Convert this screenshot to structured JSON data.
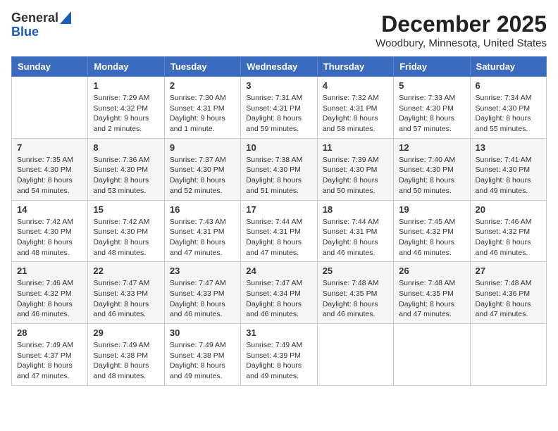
{
  "header": {
    "logo_general": "General",
    "logo_blue": "Blue",
    "month_title": "December 2025",
    "location": "Woodbury, Minnesota, United States"
  },
  "weekdays": [
    "Sunday",
    "Monday",
    "Tuesday",
    "Wednesday",
    "Thursday",
    "Friday",
    "Saturday"
  ],
  "weeks": [
    [
      {
        "day": "",
        "info": ""
      },
      {
        "day": "1",
        "info": "Sunrise: 7:29 AM\nSunset: 4:32 PM\nDaylight: 9 hours\nand 2 minutes."
      },
      {
        "day": "2",
        "info": "Sunrise: 7:30 AM\nSunset: 4:31 PM\nDaylight: 9 hours\nand 1 minute."
      },
      {
        "day": "3",
        "info": "Sunrise: 7:31 AM\nSunset: 4:31 PM\nDaylight: 8 hours\nand 59 minutes."
      },
      {
        "day": "4",
        "info": "Sunrise: 7:32 AM\nSunset: 4:31 PM\nDaylight: 8 hours\nand 58 minutes."
      },
      {
        "day": "5",
        "info": "Sunrise: 7:33 AM\nSunset: 4:30 PM\nDaylight: 8 hours\nand 57 minutes."
      },
      {
        "day": "6",
        "info": "Sunrise: 7:34 AM\nSunset: 4:30 PM\nDaylight: 8 hours\nand 55 minutes."
      }
    ],
    [
      {
        "day": "7",
        "info": "Sunrise: 7:35 AM\nSunset: 4:30 PM\nDaylight: 8 hours\nand 54 minutes."
      },
      {
        "day": "8",
        "info": "Sunrise: 7:36 AM\nSunset: 4:30 PM\nDaylight: 8 hours\nand 53 minutes."
      },
      {
        "day": "9",
        "info": "Sunrise: 7:37 AM\nSunset: 4:30 PM\nDaylight: 8 hours\nand 52 minutes."
      },
      {
        "day": "10",
        "info": "Sunrise: 7:38 AM\nSunset: 4:30 PM\nDaylight: 8 hours\nand 51 minutes."
      },
      {
        "day": "11",
        "info": "Sunrise: 7:39 AM\nSunset: 4:30 PM\nDaylight: 8 hours\nand 50 minutes."
      },
      {
        "day": "12",
        "info": "Sunrise: 7:40 AM\nSunset: 4:30 PM\nDaylight: 8 hours\nand 50 minutes."
      },
      {
        "day": "13",
        "info": "Sunrise: 7:41 AM\nSunset: 4:30 PM\nDaylight: 8 hours\nand 49 minutes."
      }
    ],
    [
      {
        "day": "14",
        "info": "Sunrise: 7:42 AM\nSunset: 4:30 PM\nDaylight: 8 hours\nand 48 minutes."
      },
      {
        "day": "15",
        "info": "Sunrise: 7:42 AM\nSunset: 4:30 PM\nDaylight: 8 hours\nand 48 minutes."
      },
      {
        "day": "16",
        "info": "Sunrise: 7:43 AM\nSunset: 4:31 PM\nDaylight: 8 hours\nand 47 minutes."
      },
      {
        "day": "17",
        "info": "Sunrise: 7:44 AM\nSunset: 4:31 PM\nDaylight: 8 hours\nand 47 minutes."
      },
      {
        "day": "18",
        "info": "Sunrise: 7:44 AM\nSunset: 4:31 PM\nDaylight: 8 hours\nand 46 minutes."
      },
      {
        "day": "19",
        "info": "Sunrise: 7:45 AM\nSunset: 4:32 PM\nDaylight: 8 hours\nand 46 minutes."
      },
      {
        "day": "20",
        "info": "Sunrise: 7:46 AM\nSunset: 4:32 PM\nDaylight: 8 hours\nand 46 minutes."
      }
    ],
    [
      {
        "day": "21",
        "info": "Sunrise: 7:46 AM\nSunset: 4:32 PM\nDaylight: 8 hours\nand 46 minutes."
      },
      {
        "day": "22",
        "info": "Sunrise: 7:47 AM\nSunset: 4:33 PM\nDaylight: 8 hours\nand 46 minutes."
      },
      {
        "day": "23",
        "info": "Sunrise: 7:47 AM\nSunset: 4:33 PM\nDaylight: 8 hours\nand 46 minutes."
      },
      {
        "day": "24",
        "info": "Sunrise: 7:47 AM\nSunset: 4:34 PM\nDaylight: 8 hours\nand 46 minutes."
      },
      {
        "day": "25",
        "info": "Sunrise: 7:48 AM\nSunset: 4:35 PM\nDaylight: 8 hours\nand 46 minutes."
      },
      {
        "day": "26",
        "info": "Sunrise: 7:48 AM\nSunset: 4:35 PM\nDaylight: 8 hours\nand 47 minutes."
      },
      {
        "day": "27",
        "info": "Sunrise: 7:48 AM\nSunset: 4:36 PM\nDaylight: 8 hours\nand 47 minutes."
      }
    ],
    [
      {
        "day": "28",
        "info": "Sunrise: 7:49 AM\nSunset: 4:37 PM\nDaylight: 8 hours\nand 47 minutes."
      },
      {
        "day": "29",
        "info": "Sunrise: 7:49 AM\nSunset: 4:38 PM\nDaylight: 8 hours\nand 48 minutes."
      },
      {
        "day": "30",
        "info": "Sunrise: 7:49 AM\nSunset: 4:38 PM\nDaylight: 8 hours\nand 49 minutes."
      },
      {
        "day": "31",
        "info": "Sunrise: 7:49 AM\nSunset: 4:39 PM\nDaylight: 8 hours\nand 49 minutes."
      },
      {
        "day": "",
        "info": ""
      },
      {
        "day": "",
        "info": ""
      },
      {
        "day": "",
        "info": ""
      }
    ]
  ]
}
